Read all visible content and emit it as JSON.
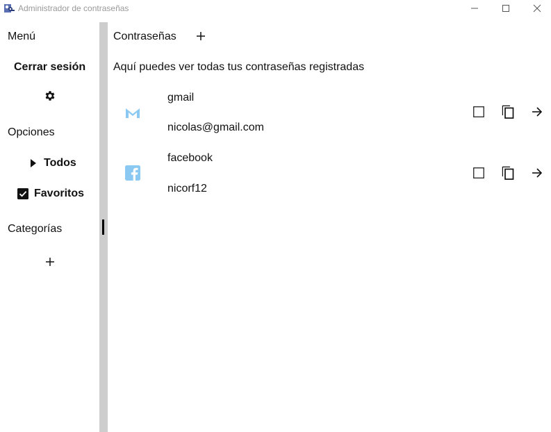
{
  "window": {
    "title": "Administrador de contraseñas",
    "icon": "keys-app-icon",
    "controls": [
      "minimize-icon",
      "maximize-icon",
      "close-icon"
    ]
  },
  "sidebar": {
    "menu_label": "Menú",
    "logout_label": "Cerrar sesión",
    "settings_icon": "gear-icon",
    "options_label": "Opciones",
    "all_label": "Todos",
    "favorites_label": "Favoritos",
    "favorites_checked": true,
    "categories_label": "Categorías",
    "add_category_icon": "plus-icon"
  },
  "main": {
    "title": "Contraseñas",
    "add_icon": "plus-icon",
    "subtitle": "Aquí puedes ver todas tus contraseñas registradas",
    "entries": [
      {
        "service": "gmail",
        "user": "nicolas@gmail.com",
        "icon": "gmail-icon",
        "favorite": false
      },
      {
        "service": "facebook",
        "user": "nicorf12",
        "icon": "facebook-icon",
        "favorite": false
      }
    ]
  },
  "colors": {
    "brand_icon": "#8cc9f2",
    "splitter": "#cdcdcd",
    "title_gray": "#9a9a9a"
  }
}
